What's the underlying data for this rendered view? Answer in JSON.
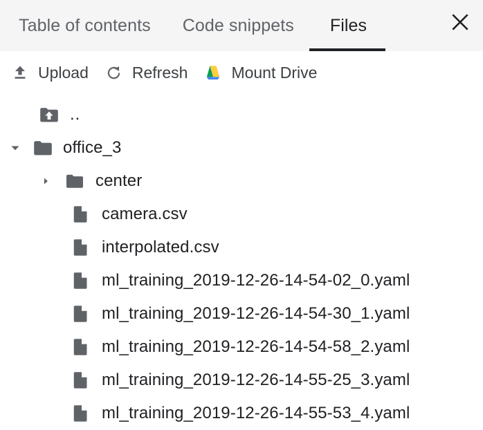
{
  "tabs": [
    {
      "label": "Table of contents",
      "active": false,
      "name": "tab-table-of-contents"
    },
    {
      "label": "Code snippets",
      "active": false,
      "name": "tab-code-snippets"
    },
    {
      "label": "Files",
      "active": true,
      "name": "tab-files"
    }
  ],
  "close_icon": "close-icon",
  "toolbar": {
    "upload_label": "Upload",
    "refresh_label": "Refresh",
    "mount_drive_label": "Mount Drive",
    "upload_icon": "upload-icon",
    "refresh_icon": "refresh-icon",
    "drive_icon": "google-drive-icon"
  },
  "colors": {
    "tabbar_background": "#f5f5f5",
    "active_tab_text": "#202124",
    "inactive_tab_text": "#5f6368",
    "active_tab_underline": "#202124",
    "icon_gray": "#5f6368",
    "drive_green": "#0f9d58",
    "drive_yellow": "#ffcd40",
    "drive_blue": "#4688f1"
  },
  "tree": {
    "rows": [
      {
        "label": "..",
        "type": "parent-folder",
        "indent": "up",
        "caret": "none",
        "icon": "folder-up-icon"
      },
      {
        "label": "office_3",
        "type": "folder",
        "indent": "0",
        "caret": "expanded",
        "icon": "folder-icon"
      },
      {
        "label": "center",
        "type": "folder",
        "indent": "1",
        "caret": "collapsed",
        "icon": "folder-icon"
      },
      {
        "label": "camera.csv",
        "type": "file",
        "indent": "1file",
        "caret": "none",
        "icon": "file-icon"
      },
      {
        "label": "interpolated.csv",
        "type": "file",
        "indent": "1file",
        "caret": "none",
        "icon": "file-icon"
      },
      {
        "label": "ml_training_2019-12-26-14-54-02_0.yaml",
        "type": "file",
        "indent": "1file",
        "caret": "none",
        "icon": "file-icon"
      },
      {
        "label": "ml_training_2019-12-26-14-54-30_1.yaml",
        "type": "file",
        "indent": "1file",
        "caret": "none",
        "icon": "file-icon"
      },
      {
        "label": "ml_training_2019-12-26-14-54-58_2.yaml",
        "type": "file",
        "indent": "1file",
        "caret": "none",
        "icon": "file-icon"
      },
      {
        "label": "ml_training_2019-12-26-14-55-25_3.yaml",
        "type": "file",
        "indent": "1file",
        "caret": "none",
        "icon": "file-icon"
      },
      {
        "label": "ml_training_2019-12-26-14-55-53_4.yaml",
        "type": "file",
        "indent": "1file",
        "caret": "none",
        "icon": "file-icon"
      }
    ]
  }
}
